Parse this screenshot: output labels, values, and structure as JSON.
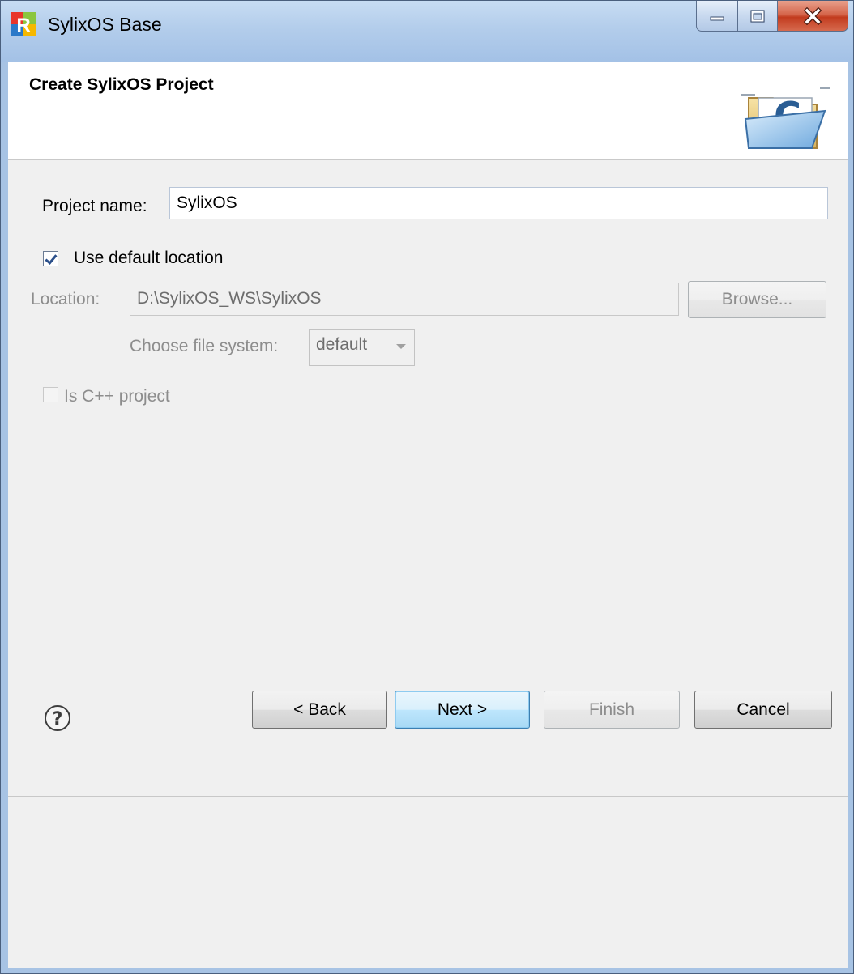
{
  "window": {
    "title": "SylixOS Base",
    "app_icon": "ide-logo-icon",
    "controls": [
      "minimize-icon",
      "maximize-icon",
      "close-icon"
    ]
  },
  "banner": {
    "title": "Create SylixOS Project",
    "icon": "c-project-folder-icon"
  },
  "form": {
    "project_name_label": "Project name:",
    "project_name_value": "SylixOS",
    "use_default_location_label": "Use default location",
    "use_default_location_checked": true,
    "location_label": "Location:",
    "location_value": "D:\\SylixOS_WS\\SylixOS",
    "browse_label": "Browse...",
    "file_system_label": "Choose file system:",
    "file_system_value": "default",
    "cpp_project_label": "Is C++ project",
    "cpp_project_checked": false
  },
  "footer": {
    "help_icon": "help-icon",
    "back_label": "< Back",
    "next_label": "Next >",
    "finish_label": "Finish",
    "cancel_label": "Cancel"
  },
  "colors": {
    "titlebar": "#b3cdeb",
    "dialog_background": "#f0f0f0",
    "close_button": "#c23b1e",
    "default_button": "#bee6fd"
  }
}
